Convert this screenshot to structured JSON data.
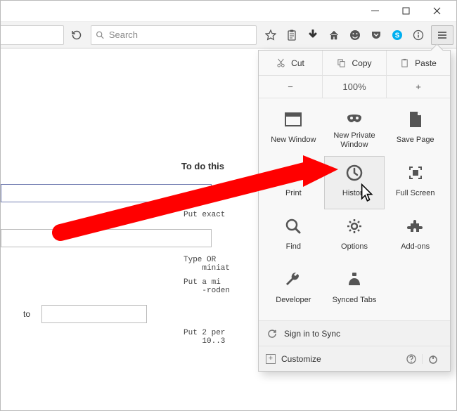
{
  "window_controls": [
    "minimize",
    "maximize",
    "close"
  ],
  "toolbar": {
    "search_placeholder": "Search",
    "icons": [
      "star",
      "clipboard",
      "download",
      "home",
      "smiley",
      "pocket",
      "skype",
      "info"
    ]
  },
  "page": {
    "heading": "To do this",
    "hint_exact": "Put exact",
    "hint_type": "Type OR\n    miniat",
    "hint_minus": "Put a mi\n    -roden",
    "hint_range": "Put 2 per\n    10..3",
    "to_label": "to"
  },
  "menu": {
    "edit": {
      "cut": "Cut",
      "copy": "Copy",
      "paste": "Paste"
    },
    "zoom": {
      "minus": "−",
      "level": "100%",
      "plus": "+"
    },
    "items": [
      {
        "label": "New Window",
        "icon": "window"
      },
      {
        "label": "New Private Window",
        "icon": "mask"
      },
      {
        "label": "Save Page",
        "icon": "page"
      },
      {
        "label": "Print",
        "icon": "printer"
      },
      {
        "label": "History",
        "icon": "history",
        "highlight": true
      },
      {
        "label": "Full Screen",
        "icon": "fullscreen"
      },
      {
        "label": "Find",
        "icon": "search"
      },
      {
        "label": "Options",
        "icon": "gear"
      },
      {
        "label": "Add-ons",
        "icon": "puzzle"
      },
      {
        "label": "Developer",
        "icon": "wrench"
      },
      {
        "label": "Synced Tabs",
        "icon": "synced"
      }
    ],
    "sync_label": "Sign in to Sync",
    "customize_label": "Customize"
  }
}
